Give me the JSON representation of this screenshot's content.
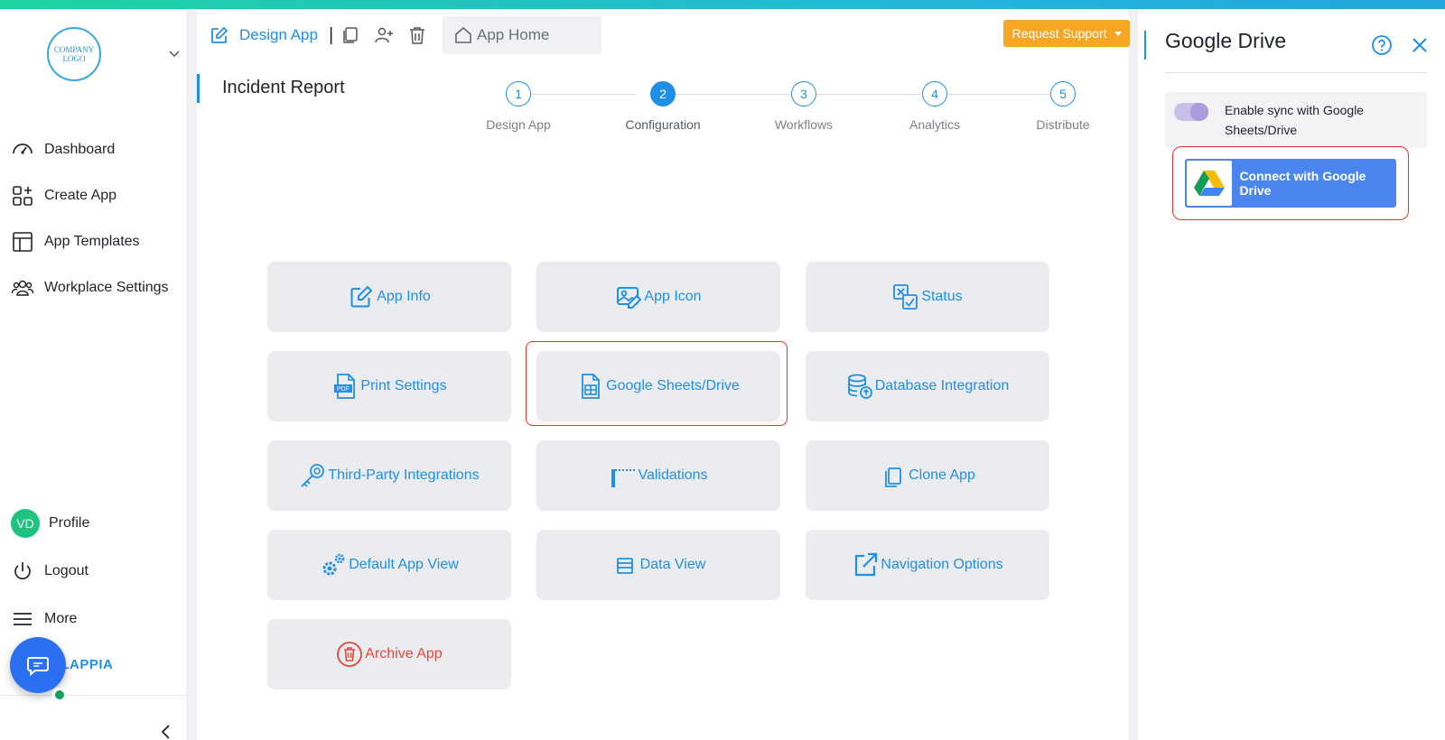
{
  "sidebar": {
    "logo_text": "COMPANY LOGO",
    "nav": [
      {
        "label": "Dashboard",
        "icon": "gauge-icon"
      },
      {
        "label": "Create App",
        "icon": "grid-plus-icon"
      },
      {
        "label": "App Templates",
        "icon": "template-icon"
      },
      {
        "label": "Workplace Settings",
        "icon": "users-icon"
      }
    ],
    "profile": {
      "initials": "VD",
      "label": "Profile"
    },
    "logout_label": "Logout",
    "more_label": "More",
    "brand_text": "CLAPPIA"
  },
  "header": {
    "active_tab_label": "Design App",
    "separator": "|",
    "home_tab_label": "App Home",
    "request_support_label": "Request Support"
  },
  "page": {
    "title": "Incident Report"
  },
  "stepper": [
    {
      "num": "1",
      "label": "Design App",
      "active": false
    },
    {
      "num": "2",
      "label": "Configuration",
      "active": true
    },
    {
      "num": "3",
      "label": "Workflows",
      "active": false
    },
    {
      "num": "4",
      "label": "Analytics",
      "active": false
    },
    {
      "num": "5",
      "label": "Distribute",
      "active": false
    }
  ],
  "cards": [
    {
      "label": "App Info",
      "icon": "edit-icon"
    },
    {
      "label": "App Icon",
      "icon": "image-edit-icon"
    },
    {
      "label": "Status",
      "icon": "status-icon"
    },
    {
      "label": "Print Settings",
      "icon": "pdf-icon"
    },
    {
      "label": "Google Sheets/Drive",
      "icon": "sheet-icon"
    },
    {
      "label": "Database Integration",
      "icon": "database-icon"
    },
    {
      "label": "Third-Party Integrations",
      "icon": "key-icon"
    },
    {
      "label": "Validations",
      "icon": "barrier-icon"
    },
    {
      "label": "Clone App",
      "icon": "copy-icon"
    },
    {
      "label": "Default App View",
      "icon": "gears-icon"
    },
    {
      "label": "Data View",
      "icon": "list-icon"
    },
    {
      "label": "Navigation Options",
      "icon": "external-link-icon"
    },
    {
      "label": "Archive App",
      "icon": "trash-circle-icon"
    }
  ],
  "panel": {
    "title": "Google Drive",
    "sync_label": "Enable sync with Google Sheets/Drive",
    "connect_label": "Connect with Google Drive"
  },
  "colors": {
    "accent": "#1f8fe8",
    "danger": "#e4483a",
    "support": "#f6a623",
    "highlight": "#e6332a"
  }
}
